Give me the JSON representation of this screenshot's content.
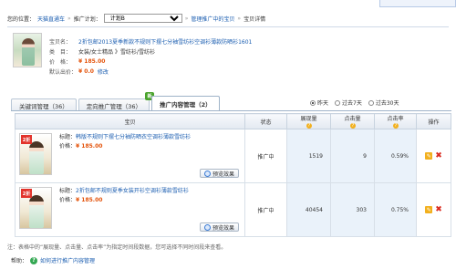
{
  "breadcrumb": {
    "prefix": "您的位置：",
    "home": "天猫直通车",
    "sep1": "»",
    "plan_label": "推广计划：",
    "plan_value": "计划B",
    "sep2": "»",
    "group": "管理推广中的宝贝",
    "sep3": "»",
    "current": "宝贝详情"
  },
  "product": {
    "title_key": "宝贝名：",
    "title": "2折包邮2013夏季新款不规则下摆七分袖雪纺衫空调衫薄款防晒衫1601",
    "category_key": "类　目：",
    "category": "女装/女士精品 》雪纺衫/雪纺衫",
    "price_key": "价　格：",
    "price": "¥ 185.00",
    "bid_key": "默认出价：",
    "bid": "¥ 0.0",
    "bid_action": "修改"
  },
  "tabs": [
    {
      "label": "关键词管理（36）",
      "active": false,
      "badge": ""
    },
    {
      "label": "定向推广管理（36）",
      "active": false,
      "badge": "新"
    },
    {
      "label": "推广内容管理（2）",
      "active": true,
      "badge": ""
    }
  ],
  "range": {
    "options": [
      "昨天",
      "过去7天",
      "过去30天"
    ],
    "selected": "昨天"
  },
  "table": {
    "headers": [
      "宝贝",
      "状态",
      "展现量",
      "点击量",
      "点击率",
      "操作"
    ],
    "help_headers": [
      false,
      false,
      true,
      true,
      true,
      false
    ],
    "rows": [
      {
        "title_label": "标题：",
        "title": "韩版不规则下摆七分袖防晒衣空调衫薄款雪纺衫",
        "price_label": "价格：",
        "price": "¥ 185.00",
        "badge": "2折",
        "preview": "预览效果",
        "status": "推广中",
        "impressions": "1519",
        "clicks": "9",
        "ctr": "0.59%"
      },
      {
        "title_label": "标题：",
        "title": "2折包邮不规则夏季女装开衫空调衫薄款雪纺衫",
        "price_label": "价格：",
        "price": "¥ 185.00",
        "badge": "2折",
        "preview": "预览效果",
        "status": "推广中",
        "impressions": "40454",
        "clicks": "303",
        "ctr": "0.75%"
      }
    ]
  },
  "footer": {
    "note": "注：表格中的“展现量、点击量、点击率”为指定时间段数据，您可选择不同时间段来查看。",
    "help_label": "帮助：",
    "help_link": "如何进行推广内容管理"
  },
  "colors": {
    "price": "#e4540c",
    "link": "#1a5db0",
    "tab_border": "#9fb3c8",
    "new_badge": "#4aa32c"
  }
}
